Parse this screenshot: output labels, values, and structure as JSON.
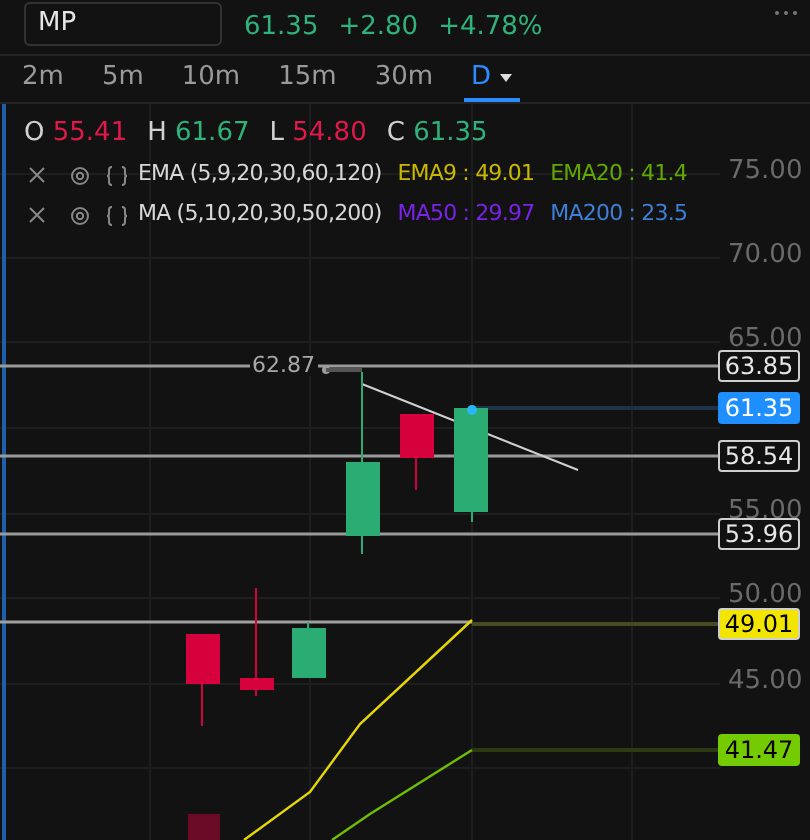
{
  "symbol_field": {
    "value": "MP"
  },
  "quote": {
    "last": "61.35",
    "change": "+2.80",
    "change_percent": "+4.78%",
    "color": "#2fb37a"
  },
  "timeframes": [
    {
      "label": "2m",
      "selected": false
    },
    {
      "label": "5m",
      "selected": false
    },
    {
      "label": "10m",
      "selected": false
    },
    {
      "label": "15m",
      "selected": false
    },
    {
      "label": "30m",
      "selected": false
    },
    {
      "label": "D",
      "selected": true
    }
  ],
  "ohlc": [
    {
      "label": "O",
      "value": "55.41",
      "color": "#e0194b"
    },
    {
      "label": "H",
      "value": "61.67",
      "color": "#2fb37a"
    },
    {
      "label": "L",
      "value": "54.80",
      "color": "#e0194b"
    },
    {
      "label": "C",
      "value": "61.35",
      "color": "#2fb37a"
    }
  ],
  "indicators": [
    {
      "name": "EMA (5,9,20,30,60,120)",
      "values": [
        {
          "text": "EMA9 : 49.01",
          "color": "#c9b800"
        },
        {
          "text": "EMA20 : 41.4",
          "color": "#62a800"
        }
      ]
    },
    {
      "name": "MA (5,10,20,30,50,200)",
      "values": [
        {
          "text": "MA50 : 29.97",
          "color": "#7a22e8"
        },
        {
          "text": "MA200 : 23.5",
          "color": "#3d7fd6"
        }
      ]
    }
  ],
  "price_axis": [
    "75.00",
    "70.00",
    "65.00",
    "55.00",
    "50.00",
    "45.00"
  ],
  "trendline_label": "62.87",
  "price_levels": [
    {
      "label": "63.85",
      "kind": "line"
    },
    {
      "label": "61.35",
      "kind": "last"
    },
    {
      "label": "58.54",
      "kind": "line"
    },
    {
      "label": "53.96",
      "kind": "line"
    },
    {
      "label": "49.01",
      "kind": "ema9"
    },
    {
      "label": "41.47",
      "kind": "ema20"
    }
  ]
}
